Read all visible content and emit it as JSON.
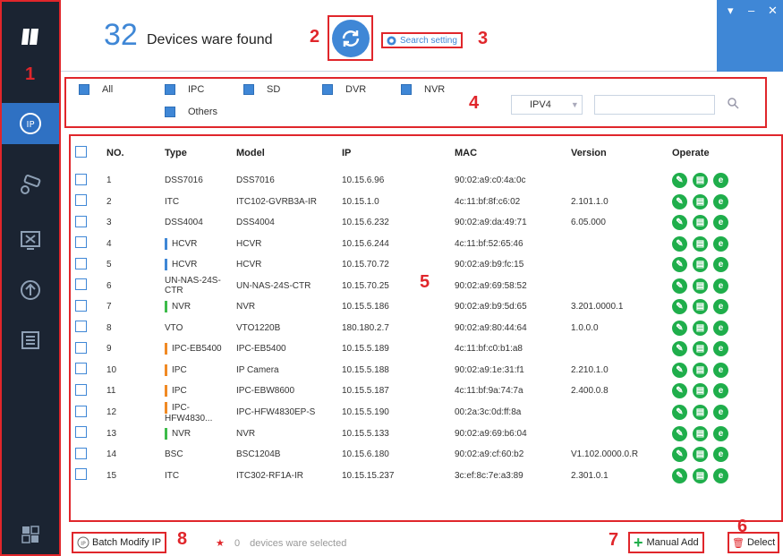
{
  "header": {
    "device_count": "32",
    "count_label": "Devices ware found",
    "search_setting": "Search setting"
  },
  "callouts": [
    "1",
    "2",
    "3",
    "4",
    "5",
    "6",
    "7",
    "8"
  ],
  "filters": {
    "all": "All",
    "ipc": "IPC",
    "sd": "SD",
    "dvr": "DVR",
    "nvr": "NVR",
    "others": "Others",
    "ip_version": "IPV4"
  },
  "table": {
    "headers": [
      "NO.",
      "Type",
      "Model",
      "IP",
      "MAC",
      "Version",
      "Operate"
    ],
    "rows": [
      {
        "no": "1",
        "type": "DSS7016",
        "model": "DSS7016",
        "ip": "10.15.6.96",
        "mac": "90:02:a9:c0:4a:0c",
        "version": ""
      },
      {
        "no": "2",
        "type": "ITC",
        "model": "ITC102-GVRB3A-IR",
        "ip": "10.15.1.0",
        "mac": "4c:11:bf:8f:c6:02",
        "version": "2.101.1.0"
      },
      {
        "no": "3",
        "type": "DSS4004",
        "model": "DSS4004",
        "ip": "10.15.6.232",
        "mac": "90:02:a9:da:49:71",
        "version": "6.05.000"
      },
      {
        "no": "4",
        "type": "HCVR",
        "model": "HCVR",
        "ip": "10.15.6.244",
        "mac": "4c:11:bf:52:65:46",
        "version": ""
      },
      {
        "no": "5",
        "type": "HCVR",
        "model": "HCVR",
        "ip": "10.15.70.72",
        "mac": "90:02:a9:b9:fc:15",
        "version": ""
      },
      {
        "no": "6",
        "type": "UN-NAS-24S-CTR",
        "model": "UN-NAS-24S-CTR",
        "ip": "10.15.70.25",
        "mac": "90:02:a9:69:58:52",
        "version": ""
      },
      {
        "no": "7",
        "type": "NVR",
        "model": "NVR",
        "ip": "10.15.5.186",
        "mac": "90:02:a9:b9:5d:65",
        "version": "3.201.0000.1"
      },
      {
        "no": "8",
        "type": "VTO",
        "model": "VTO1220B",
        "ip": "180.180.2.7",
        "mac": "90:02:a9:80:44:64",
        "version": "1.0.0.0"
      },
      {
        "no": "9",
        "type": "IPC-EB5400",
        "model": "IPC-EB5400",
        "ip": "10.15.5.189",
        "mac": "4c:11:bf:c0:b1:a8",
        "version": ""
      },
      {
        "no": "10",
        "type": "IPC",
        "model": "IP Camera",
        "ip": "10.15.5.188",
        "mac": "90:02:a9:1e:31:f1",
        "version": "2.210.1.0"
      },
      {
        "no": "11",
        "type": "IPC",
        "model": "IPC-EBW8600",
        "ip": "10.15.5.187",
        "mac": "4c:11:bf:9a:74:7a",
        "version": "2.400.0.8"
      },
      {
        "no": "12",
        "type": "IPC-HFW4830...",
        "model": "IPC-HFW4830EP-S",
        "ip": "10.15.5.190",
        "mac": "00:2a:3c:0d:ff:8a",
        "version": ""
      },
      {
        "no": "13",
        "type": "NVR",
        "model": "NVR",
        "ip": "10.15.5.133",
        "mac": "90:02:a9:69:b6:04",
        "version": ""
      },
      {
        "no": "14",
        "type": "BSC",
        "model": "BSC1204B",
        "ip": "10.15.6.180",
        "mac": "90:02:a9:cf:60:b2",
        "version": "V1.102.0000.0.R"
      },
      {
        "no": "15",
        "type": "ITC",
        "model": "ITC302-RF1A-IR",
        "ip": "10.15.15.237",
        "mac": "3c:ef:8c:7e:a3:89",
        "version": "2.301.0.1"
      }
    ]
  },
  "footer": {
    "batch_modify": "Batch Modify IP",
    "selected_count": "0",
    "selected_label": "devices ware selected",
    "manual_add": "Manual Add",
    "delect": "Delect"
  },
  "colors": {
    "accent": "#3f87d6",
    "sidebar": "#1b2432",
    "callout": "#e0262b",
    "operate": "#1fae4b",
    "hcvr_bar": "#3f87d6",
    "nvr_bar": "#3dbb4a",
    "ipc_bar": "#f08a24"
  }
}
